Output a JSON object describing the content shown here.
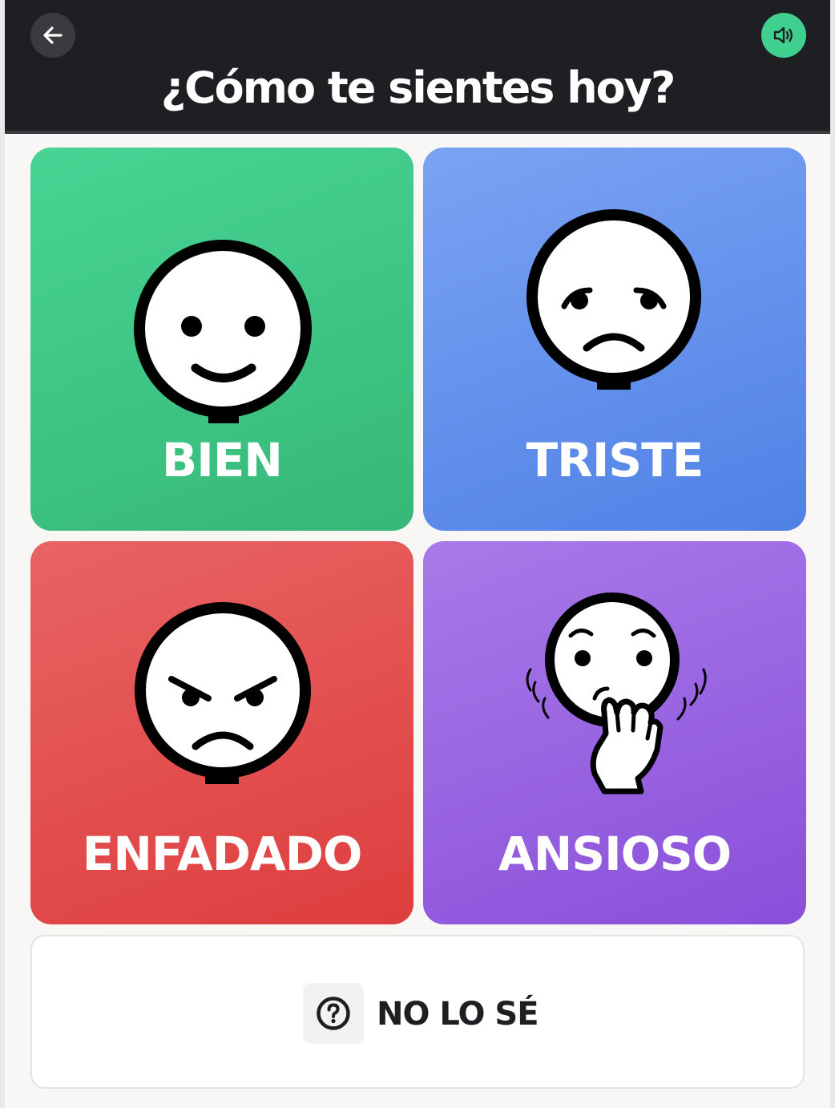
{
  "header": {
    "title": "¿Cómo te sientes hoy?",
    "back_icon": "arrow-left-icon",
    "sound_icon": "speaker-icon"
  },
  "emotions": [
    {
      "label": "BIEN",
      "icon": "happy-face-icon",
      "color": "#3fc886"
    },
    {
      "label": "TRISTE",
      "icon": "sad-face-icon",
      "color": "#6592ec"
    },
    {
      "label": "ENFADADO",
      "icon": "angry-face-icon",
      "color": "#e35050"
    },
    {
      "label": "ANSIOSO",
      "icon": "anxious-face-icon",
      "color": "#9a65e1"
    }
  ],
  "unknown_option": {
    "label": "NO LO SÉ",
    "icon": "question-circle-icon"
  },
  "colors": {
    "header_bg": "#1e1f22",
    "accent": "#3fcf8e"
  }
}
